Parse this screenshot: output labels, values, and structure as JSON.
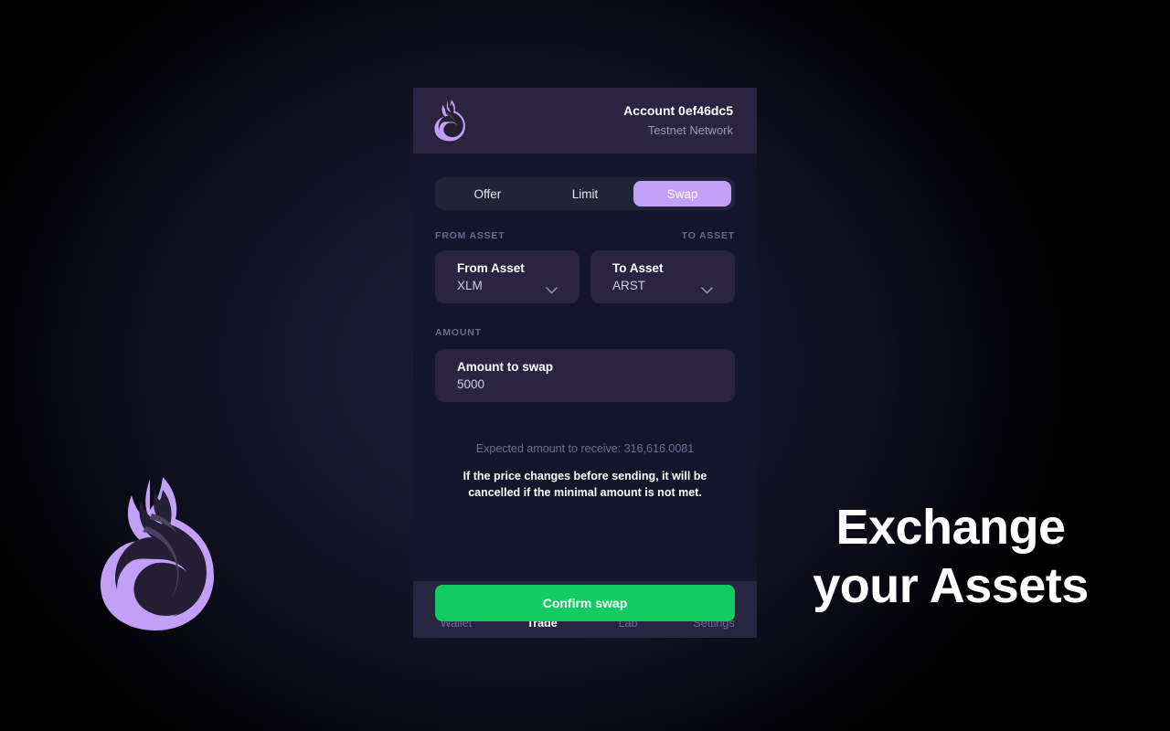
{
  "background": {
    "page_color": "#000000",
    "vignette_color": "#1b1b33"
  },
  "brand": {
    "logo_large_name": "cat-lemur-logo",
    "logo_small_name": "cat-lemur-logo-small",
    "accent_purple": "#c3a0f7",
    "logo_dark": "#241f33"
  },
  "marketing": {
    "line1": "Exchange",
    "line2": "your Assets"
  },
  "header": {
    "account_label": "Account 0ef46dc5",
    "network_label": "Testnet Network"
  },
  "tabs": [
    {
      "label": "Offer",
      "active": false
    },
    {
      "label": "Limit",
      "active": false
    },
    {
      "label": "Swap",
      "active": true
    }
  ],
  "form": {
    "from_section_label": "FROM ASSET",
    "to_section_label": "TO ASSET",
    "amount_section_label": "AMOUNT",
    "from_asset": {
      "title": "From Asset",
      "value": "XLM",
      "chevron": "chevron-down-icon"
    },
    "to_asset": {
      "title": "To Asset",
      "value": "ARST",
      "chevron": "chevron-down-icon"
    },
    "amount": {
      "title": "Amount to swap",
      "value": "5000"
    }
  },
  "info": {
    "expected_text": "Expected amount to receive: 316,616.0081",
    "warning_line1": "If the price changes before sending, it will be",
    "warning_line2": "cancelled if the minimal amount is not met."
  },
  "actions": {
    "confirm_label": "Confirm swap",
    "confirm_color": "#13cb63"
  },
  "bottom_nav": [
    {
      "label": "Wallet",
      "icon": "wallet-card-icon",
      "active": false
    },
    {
      "label": "Trade",
      "icon": "swap-arrows-icon",
      "active": true
    },
    {
      "label": "Lab",
      "icon": "flask-icon",
      "active": false
    },
    {
      "label": "Settings",
      "icon": "gear-icon",
      "active": false
    }
  ]
}
